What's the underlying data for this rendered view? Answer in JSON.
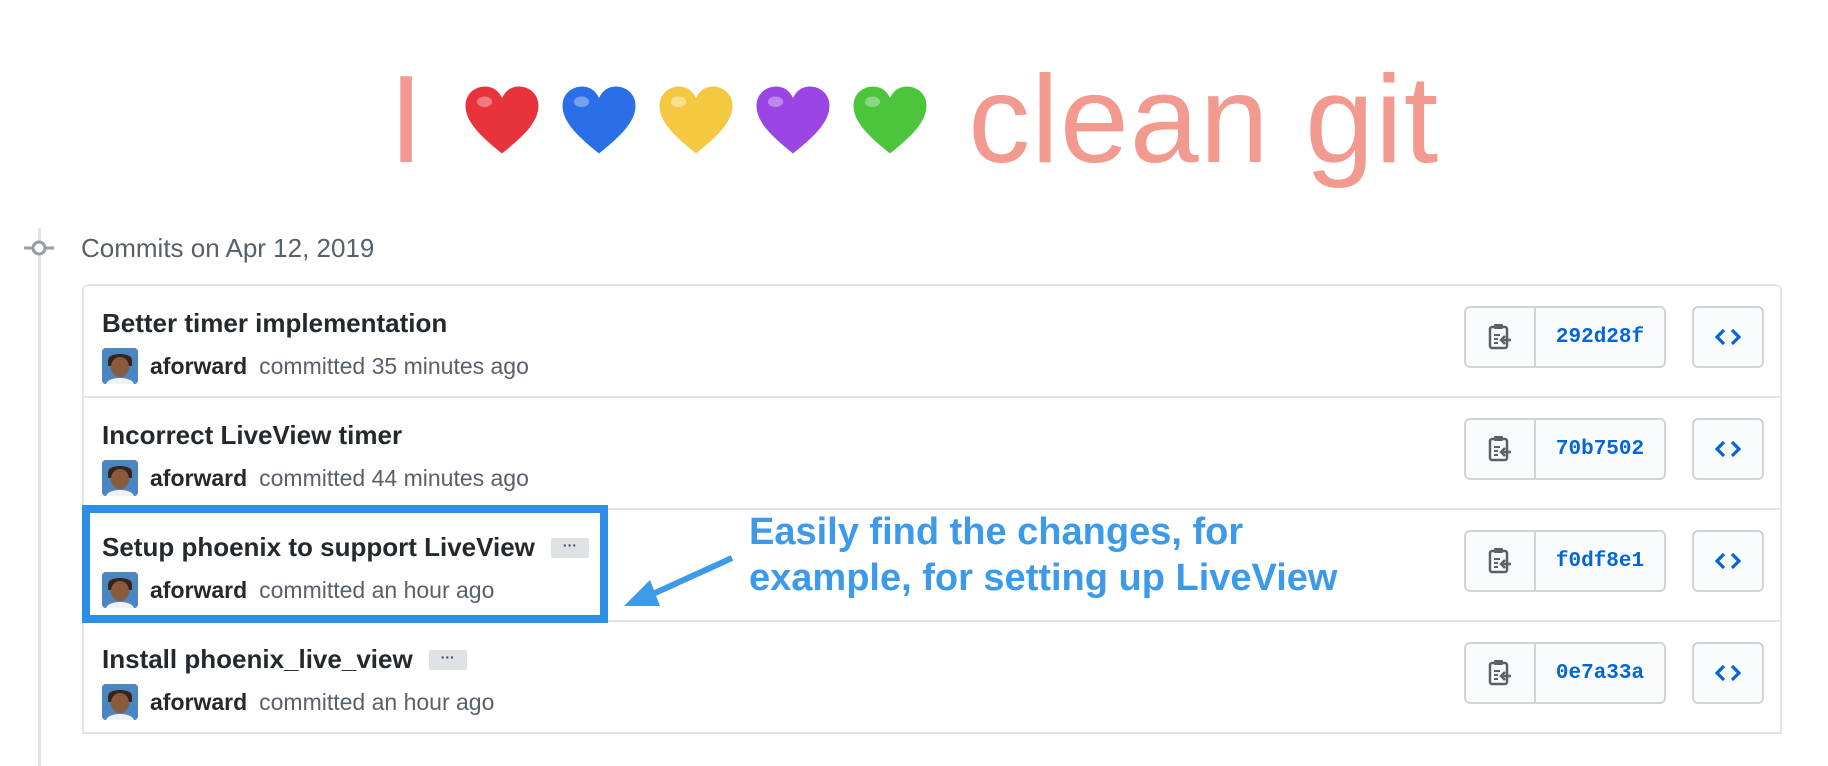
{
  "banner": {
    "prefix": "I",
    "suffix": "clean git",
    "hearts": [
      {
        "name": "red-heart-icon",
        "color": "#e8323c"
      },
      {
        "name": "blue-heart-icon",
        "color": "#2a6fe8"
      },
      {
        "name": "yellow-heart-icon",
        "color": "#f5c842"
      },
      {
        "name": "purple-heart-icon",
        "color": "#9b45e4"
      },
      {
        "name": "green-heart-icon",
        "color": "#4cc43c"
      }
    ]
  },
  "group": {
    "date_label": "Commits on Apr 12, 2019",
    "icon": "git-commit-icon"
  },
  "commits": [
    {
      "title": "Better timer implementation",
      "has_ellipsis": false,
      "ellipsis": "",
      "author": "aforward",
      "meta": "committed 35 minutes ago",
      "sha": "292d28f"
    },
    {
      "title": "Incorrect LiveView timer",
      "has_ellipsis": false,
      "ellipsis": "",
      "author": "aforward",
      "meta": "committed 44 minutes ago",
      "sha": "70b7502"
    },
    {
      "title": "Setup phoenix to support LiveView",
      "has_ellipsis": true,
      "ellipsis": "···",
      "author": "aforward",
      "meta": "committed an hour ago",
      "sha": "f0df8e1"
    },
    {
      "title": "Install phoenix_live_view",
      "has_ellipsis": true,
      "ellipsis": "···",
      "author": "aforward",
      "meta": "committed an hour ago",
      "sha": "0e7a33a"
    }
  ],
  "icons": {
    "copy": "clipboard-icon",
    "browse": "code-icon"
  },
  "annotation": {
    "line1": "Easily find the changes, for",
    "line2": "example, for setting up LiveView",
    "color": "#3d9ae8",
    "box_color": "#2e8ee6"
  },
  "colors": {
    "banner_text": "#f29a90",
    "sha_link": "#0366d6"
  }
}
